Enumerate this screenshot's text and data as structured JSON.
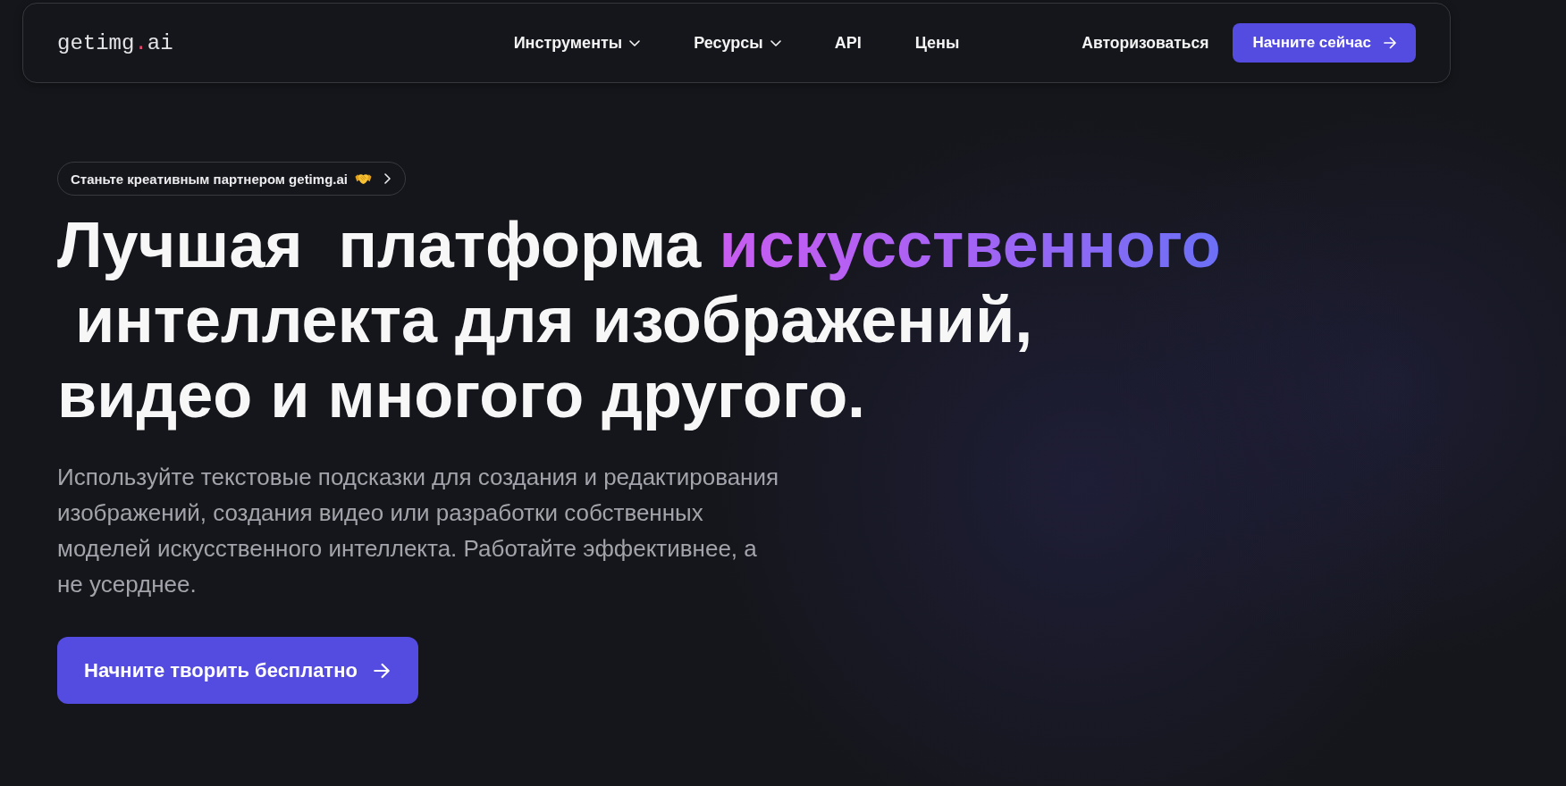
{
  "nav": {
    "logo": [
      {
        "text": "getimg",
        "accent": false
      },
      {
        "text": ".",
        "accent": true
      },
      {
        "text": "ai",
        "accent": false
      }
    ],
    "links": [
      {
        "label": "Инструменты",
        "kind": "dropdown"
      },
      {
        "label": "Ресурсы",
        "kind": "dropdown"
      },
      {
        "label": "API",
        "kind": "link"
      },
      {
        "label": "Цены",
        "kind": "link"
      }
    ],
    "login": "Авторизоваться",
    "cta": "Начните сейчас"
  },
  "hero": {
    "badge": "Станьте креативным партнером getimg.ai",
    "heading": [
      {
        "text": "Лучшая  платформа ",
        "accent": false
      },
      {
        "text": "искусственного",
        "accent": true
      },
      {
        "text": " интеллекта для изображений, видео и многого другого.",
        "accent": false
      }
    ],
    "description": "Используйте текстовые подсказки для создания и редактирования изображений, создания видео или разработки собственных моделей искусственного интеллекта. Работайте эффективнее, а не усерднее.",
    "cta": "Начните творить бесплатно"
  }
}
